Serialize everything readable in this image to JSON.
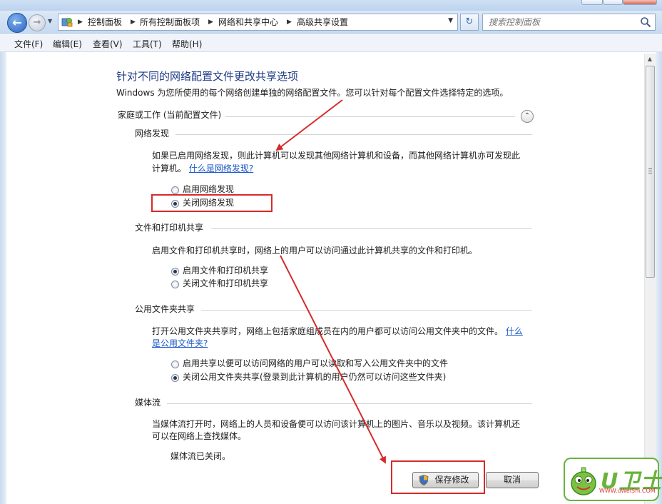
{
  "address_bar": {
    "breadcrumb": [
      "控制面板",
      "所有控制面板项",
      "网络和共享中心",
      "高级共享设置"
    ],
    "search_placeholder": "搜索控制面板"
  },
  "menu": [
    "文件(F)",
    "编辑(E)",
    "查看(V)",
    "工具(T)",
    "帮助(H)"
  ],
  "page": {
    "title": "针对不同的网络配置文件更改共享选项",
    "intro": "Windows 为您所使用的每个网络创建单独的网络配置文件。您可以针对每个配置文件选择特定的选项。",
    "profile_header": "家庭或工作 (当前配置文件)"
  },
  "network_discovery": {
    "header": "网络发现",
    "desc_1": "如果已启用网络发现，则此计算机可以发现其他网络计算机和设备，而其他网络计算机亦可发现此",
    "desc_2": "计算机。",
    "link": "什么是网络发现?",
    "option_on": "启用网络发现",
    "option_off": "关闭网络发现",
    "selected": "off"
  },
  "file_printer_sharing": {
    "header": "文件和打印机共享",
    "desc": "启用文件和打印机共享时，网络上的用户可以访问通过此计算机共享的文件和打印机。",
    "option_on": "启用文件和打印机共享",
    "option_off": "关闭文件和打印机共享",
    "selected": "on"
  },
  "public_folder_sharing": {
    "header": "公用文件夹共享",
    "desc_1": "打开公用文件夹共享时，网络上包括家庭组成员在内的用户都可以访问公用文件夹中的文件。",
    "link_1": "什么",
    "link_2": "是公用文件夹?",
    "option_on": "启用共享以便可以访问网络的用户可以读取和写入公用文件夹中的文件",
    "option_off": "关闭公用文件夹共享(登录到此计算机的用户仍然可以访问这些文件夹)",
    "selected": "off"
  },
  "media_streaming": {
    "header": "媒体流",
    "desc_1": "当媒体流打开时，网络上的人员和设备便可以访问该计算机上的图片、音乐以及视频。该计算机还",
    "desc_2": "可以在网络上查找媒体。",
    "status": "媒体流已关闭。"
  },
  "buttons": {
    "save": "保存修改",
    "cancel": "取消"
  },
  "watermark": {
    "logo_text": "U卫士",
    "url": "WWW.uWeiShi.COM"
  },
  "colors": {
    "title_blue": "#1f3b87",
    "link_blue": "#1a56c8",
    "annotation_red": "#d62a2a"
  }
}
